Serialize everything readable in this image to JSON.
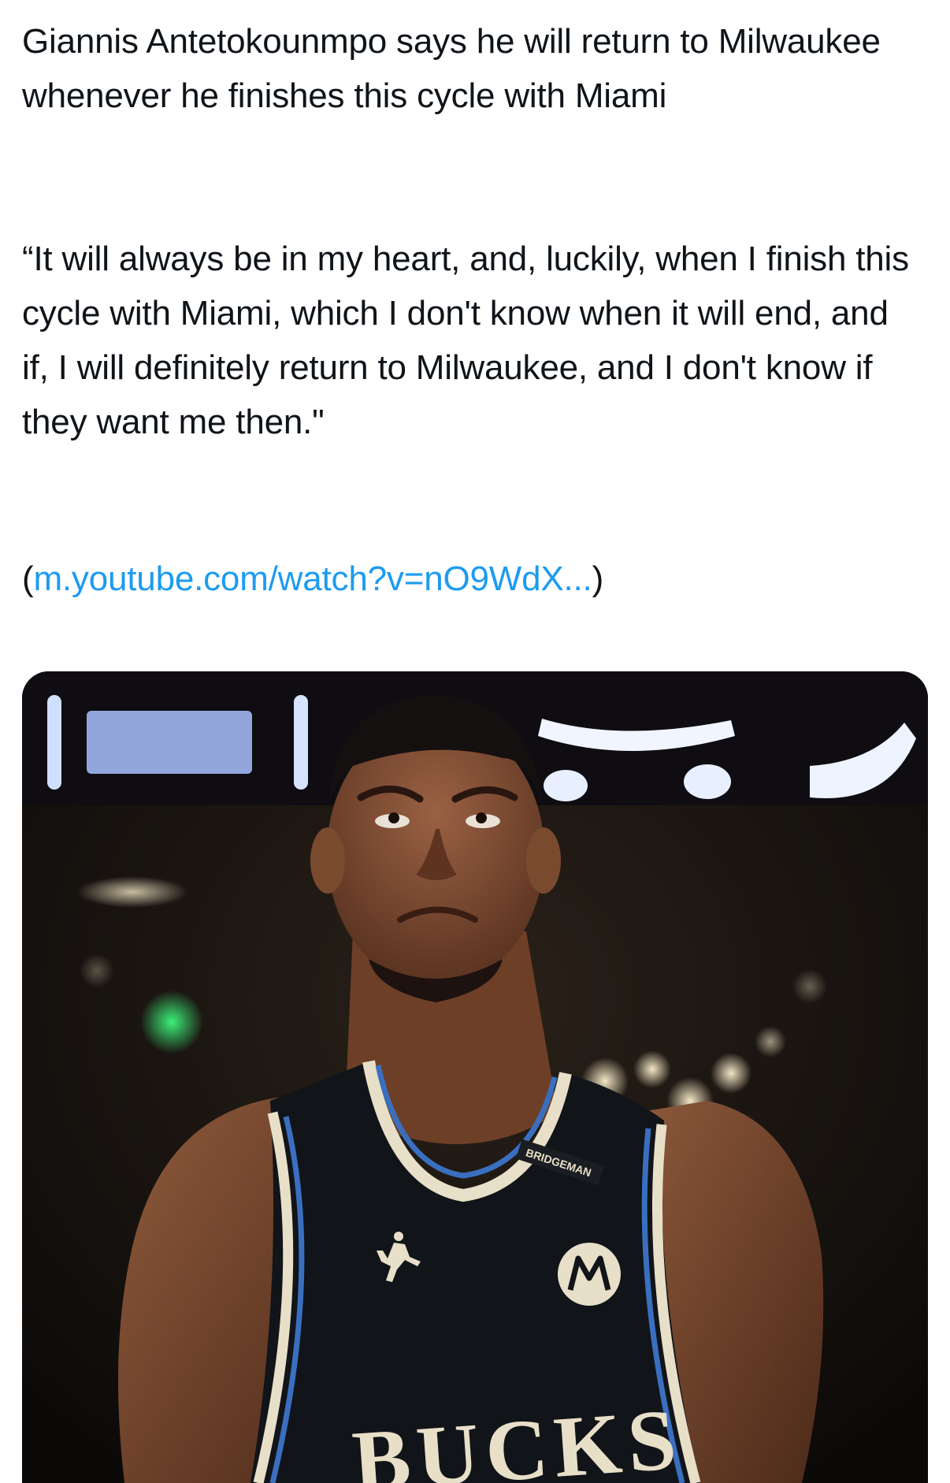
{
  "post": {
    "headline": "Giannis Antetokounmpo says he will return to Milwaukee whenever he finishes this cycle with Miami",
    "quote": "“It will always be in my heart, and, luckily, when I finish this cycle with Miami, which I don't know when it will end, and if, I will definitely return to Milwaukee, and I don't know if they want me then.\"",
    "link_text": "m.youtube.com/watch?v=nO9WdX...",
    "link_open": "(",
    "link_close": ")"
  },
  "media": {
    "jersey_text": "BUCKS",
    "sponsor_text": "BRIDGEMAN"
  },
  "colors": {
    "link": "#1d9bf0",
    "text": "#0f1419",
    "jersey": "#111418",
    "jersey_trim_cream": "#e8dfc8",
    "jersey_trim_blue": "#3a6fc0",
    "skin": "#7a4a2f"
  }
}
